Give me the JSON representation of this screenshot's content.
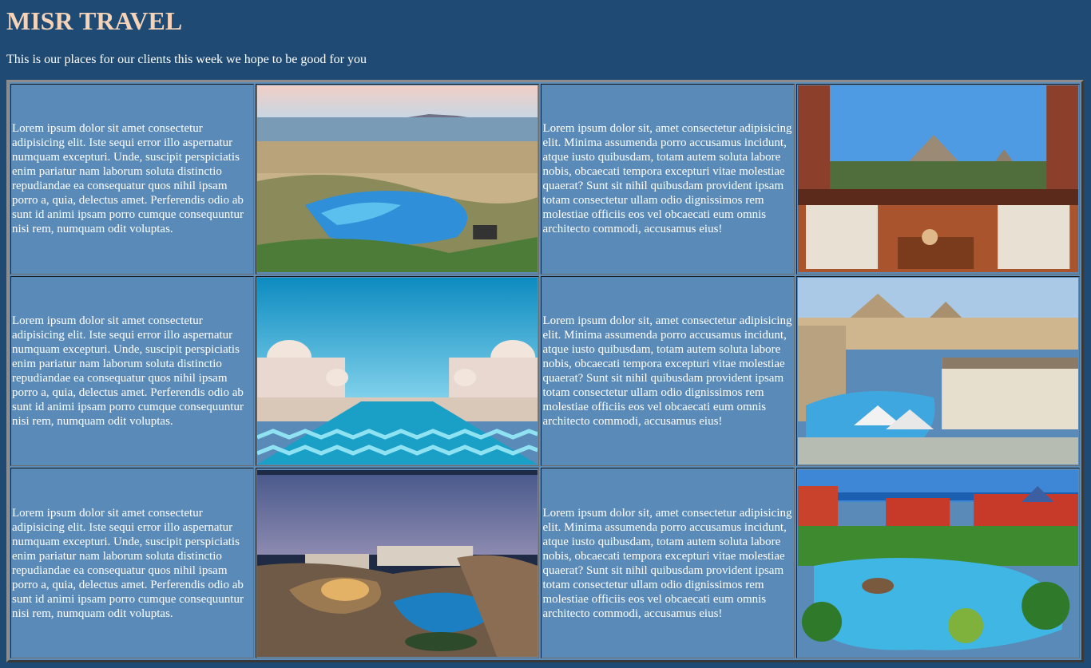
{
  "header": {
    "title": "MISR TRAVEL",
    "intro": "This is our places for our clients this week we hope to be good for you"
  },
  "rows": [
    {
      "text_left": "Lorem ipsum dolor sit amet consectetur adipisicing elit. Iste sequi error illo aspernatur numquam excepturi. Unde, suscipit perspiciatis enim pariatur nam laborum soluta distinctio repudiandae ea consequatur quos nihil ipsam porro a, quia, delectus amet. Perferendis odio ab sunt id animi ipsam porro cumque consequuntur nisi rem, numquam odit voluptas.",
      "image_left": "resort-aerial-sea-photo",
      "text_right": "Lorem ipsum dolor sit, amet consectetur adipisicing elit. Minima assumenda porro accusamus incidunt, atque iusto quibusdam, totam autem soluta labore nobis, obcaecati tempora excepturi vitae molestiae quaerat? Sunt sit nihil quibusdam provident ipsam totam consectetur ullam odio dignissimos rem molestiae officiis eos vel obcaecati eum omnis architecto commodi, accusamus eius!",
      "image_right": "pyramids-balcony-view-photo"
    },
    {
      "text_left": "Lorem ipsum dolor sit amet consectetur adipisicing elit. Iste sequi error illo aspernatur numquam excepturi. Unde, suscipit perspiciatis enim pariatur nam laborum soluta distinctio repudiandae ea consequatur quos nihil ipsam porro a, quia, delectus amet. Perferendis odio ab sunt id animi ipsam porro cumque consequuntur nisi rem, numquam odit voluptas.",
      "image_left": "domed-palace-pool-photo",
      "text_right": "Lorem ipsum dolor sit, amet consectetur adipisicing elit. Minima assumenda porro accusamus incidunt, atque iusto quibusdam, totam autem soluta labore nobis, obcaecati tempora excepturi vitae molestiae quaerat? Sunt sit nihil quibusdam provident ipsam totam consectetur ullam odio dignissimos rem molestiae officiis eos vel obcaecati eum omnis architecto commodi, accusamus eius!",
      "image_right": "pyramids-hotel-pool-photo"
    },
    {
      "text_left": "Lorem ipsum dolor sit amet consectetur adipisicing elit. Iste sequi error illo aspernatur numquam excepturi. Unde, suscipit perspiciatis enim pariatur nam laborum soluta distinctio repudiandae ea consequatur quos nihil ipsam porro a, quia, delectus amet. Perferendis odio ab sunt id animi ipsam porro cumque consequuntur nisi rem, numquam odit voluptas.",
      "image_left": "rocky-resort-night-photo",
      "text_right": "Lorem ipsum dolor sit, amet consectetur adipisicing elit. Minima assumenda porro accusamus incidunt, atque iusto quibusdam, totam autem soluta labore nobis, obcaecati tempora excepturi vitae molestiae quaerat? Sunt sit nihil quibusdam provident ipsam totam consectetur ullam odio dignissimos rem molestiae officiis eos vel obcaecati eum omnis architecto commodi, accusamus eius!",
      "image_right": "red-palace-pool-photo"
    }
  ],
  "colors": {
    "background": "#1e4a73",
    "title": "#f4d3b8",
    "cell": "#5a8ab8"
  }
}
